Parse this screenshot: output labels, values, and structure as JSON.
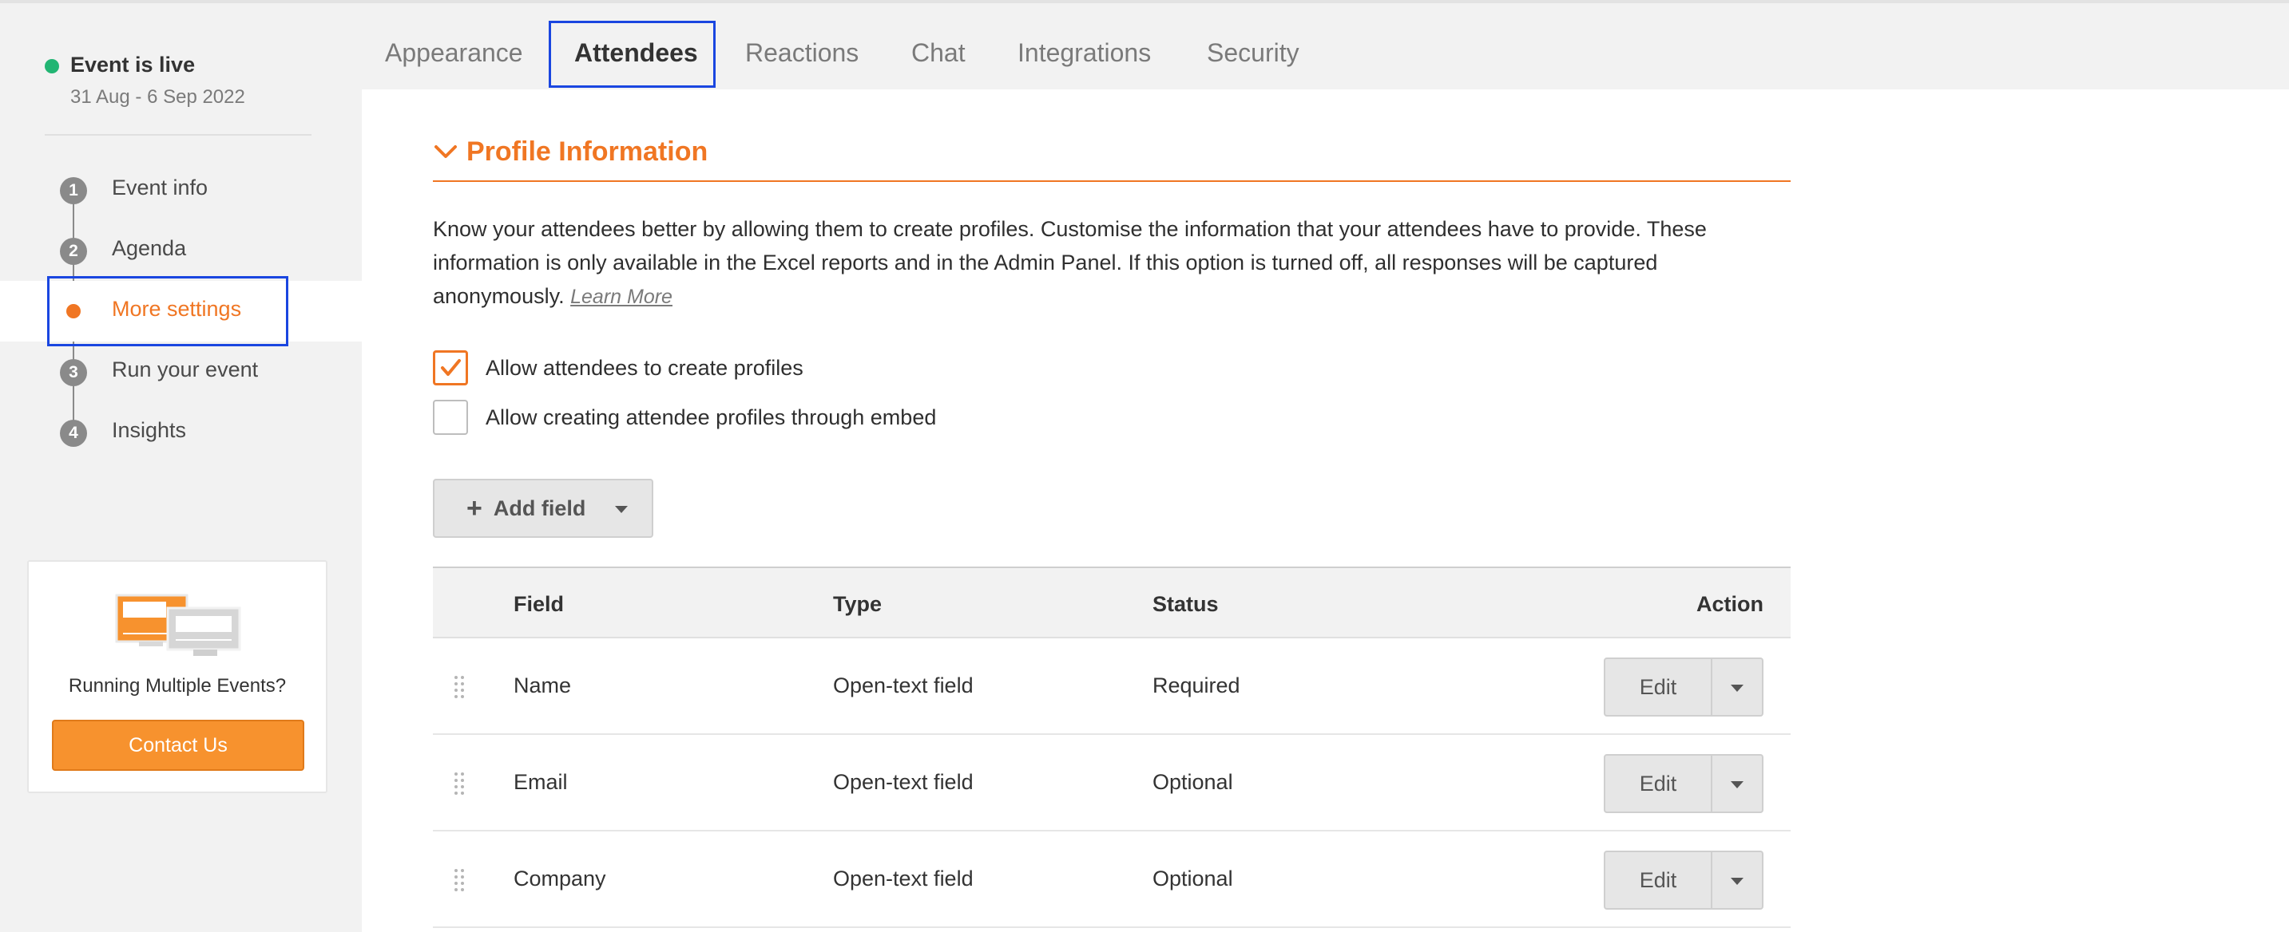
{
  "event_status": {
    "title": "Event is live",
    "dates": "31 Aug - 6 Sep 2022",
    "status_color": "#22b573"
  },
  "steps": [
    {
      "number": "1",
      "label": "Event info"
    },
    {
      "number": "2",
      "label": "Agenda"
    },
    {
      "number": "",
      "label": "More settings",
      "active": true
    },
    {
      "number": "3",
      "label": "Run your event"
    },
    {
      "number": "4",
      "label": "Insights"
    }
  ],
  "promo": {
    "text": "Running Multiple Events?",
    "button_label": "Contact Us"
  },
  "tabs": [
    {
      "label": "Appearance"
    },
    {
      "label": "Attendees",
      "active": true
    },
    {
      "label": "Reactions"
    },
    {
      "label": "Chat"
    },
    {
      "label": "Integrations"
    },
    {
      "label": "Security"
    }
  ],
  "section": {
    "title": "Profile Information",
    "description": "Know your attendees better by allowing them to create profiles. Customise the information that your attendees have to provide. These information is only available in the Excel reports and in the Admin Panel. If this option is turned off, all responses will be captured anonymously.",
    "learn_more": "Learn More"
  },
  "options": [
    {
      "label": "Allow attendees to create profiles",
      "checked": true
    },
    {
      "label": "Allow creating attendee profiles through embed",
      "checked": false
    }
  ],
  "add_field_label": "Add field",
  "table": {
    "headers": {
      "field": "Field",
      "type": "Type",
      "status": "Status",
      "action": "Action"
    },
    "rows": [
      {
        "field": "Name",
        "type": "Open-text field",
        "status": "Required",
        "action": "Edit"
      },
      {
        "field": "Email",
        "type": "Open-text field",
        "status": "Optional",
        "action": "Edit"
      },
      {
        "field": "Company",
        "type": "Open-text field",
        "status": "Optional",
        "action": "Edit"
      }
    ]
  },
  "colors": {
    "accent": "#f07623",
    "highlight": "#1a46e0",
    "contact_button": "#f7922e"
  }
}
